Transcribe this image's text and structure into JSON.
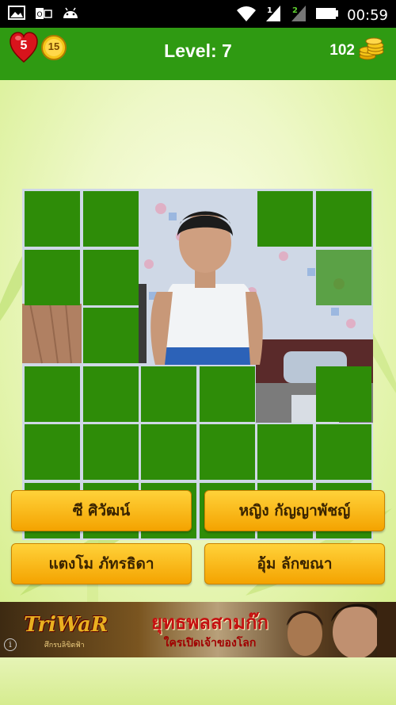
{
  "status_bar": {
    "time": "00:59",
    "left_icons": [
      "image-icon",
      "outlook-icon",
      "android-icon"
    ],
    "right_icons": [
      "wifi-icon",
      "signal-1-icon",
      "signal-2-icon",
      "battery-icon"
    ],
    "signal_slot_1": "1",
    "signal_slot_2": "2"
  },
  "header": {
    "lives": "5",
    "hints": "15",
    "level_label": "Level: 7",
    "coins": "102",
    "bg_color": "#2f9a12"
  },
  "puzzle": {
    "grid_rows": 6,
    "grid_cols": 6,
    "tile_color": "#2e8c08",
    "revealed_tiles": [
      [
        0,
        2
      ],
      [
        0,
        3
      ],
      [
        1,
        2
      ],
      [
        1,
        3
      ],
      [
        1,
        4
      ],
      [
        2,
        0
      ],
      [
        2,
        2
      ],
      [
        2,
        3
      ],
      [
        2,
        4
      ],
      [
        2,
        5
      ],
      [
        3,
        4
      ]
    ],
    "partially_revealed_tiles": [
      [
        1,
        5
      ]
    ]
  },
  "answers": [
    {
      "label": "ซี ศิวัฒน์"
    },
    {
      "label": "หญิง กัญญาพัชญ์"
    },
    {
      "label": "แตงโม ภัทรธิดา"
    },
    {
      "label": "อุ้ม ลักขณา"
    }
  ],
  "ad": {
    "brand": "TriWaR",
    "brand_sub": "ศึกรบลิขิตฟ้า",
    "headline": "ยุทธพลสามก๊ก",
    "subline": "ใครเปิดเจ้าของโลก",
    "info_icon": "info-icon"
  }
}
